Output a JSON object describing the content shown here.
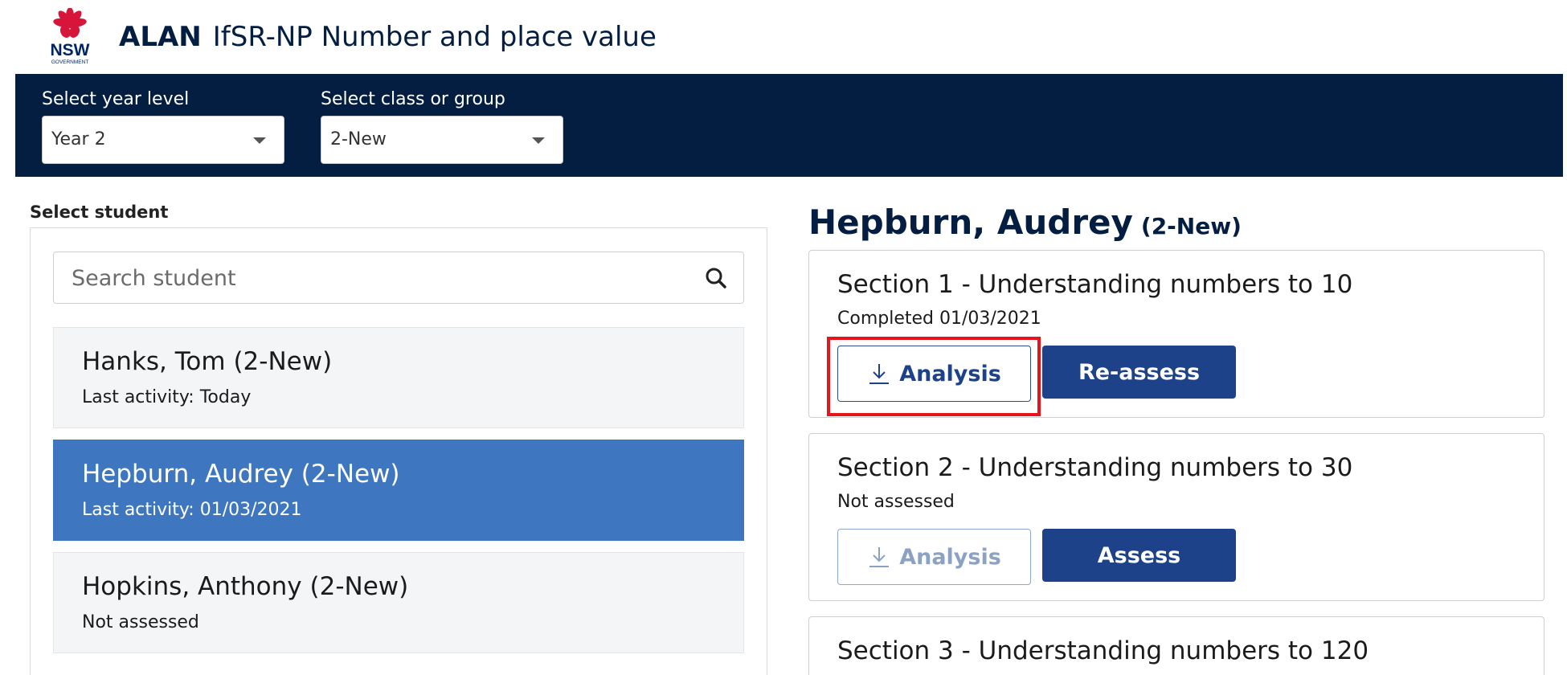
{
  "header": {
    "brand": "ALAN",
    "subtitle": "IfSR-NP Number and place value",
    "logo_text": "NSW",
    "logo_subtext": "GOVERNMENT"
  },
  "filters": {
    "year_label": "Select year level",
    "year_value": "Year 2",
    "class_label": "Select class or group",
    "class_value": "2-New"
  },
  "students_panel": {
    "label": "Select student",
    "search_placeholder": "Search student",
    "students": [
      {
        "name": "Hanks, Tom (2-New)",
        "activity": "Last activity: Today",
        "selected": false
      },
      {
        "name": "Hepburn, Audrey (2-New)",
        "activity": "Last activity: 01/03/2021",
        "selected": true
      },
      {
        "name": "Hopkins, Anthony (2-New)",
        "activity": "Not assessed",
        "selected": false
      }
    ]
  },
  "detail": {
    "student_name": "Hepburn, Audrey",
    "student_group": "(2-New)",
    "sections": [
      {
        "title": "Section 1 - Understanding numbers to 10",
        "status": "Completed 01/03/2021",
        "analysis_label": "Analysis",
        "action_label": "Re-assess",
        "analysis_enabled": true
      },
      {
        "title": "Section 2 - Understanding numbers to 30",
        "status": "Not assessed",
        "analysis_label": "Analysis",
        "action_label": "Assess",
        "analysis_enabled": false
      },
      {
        "title": "Section 3 - Understanding numbers to 120"
      }
    ]
  },
  "colors": {
    "navy": "#041e42",
    "primary_button": "#1d428a",
    "selected_row": "#3e77bf",
    "highlight": "#e8141c",
    "nsw_red": "#d7153a"
  }
}
